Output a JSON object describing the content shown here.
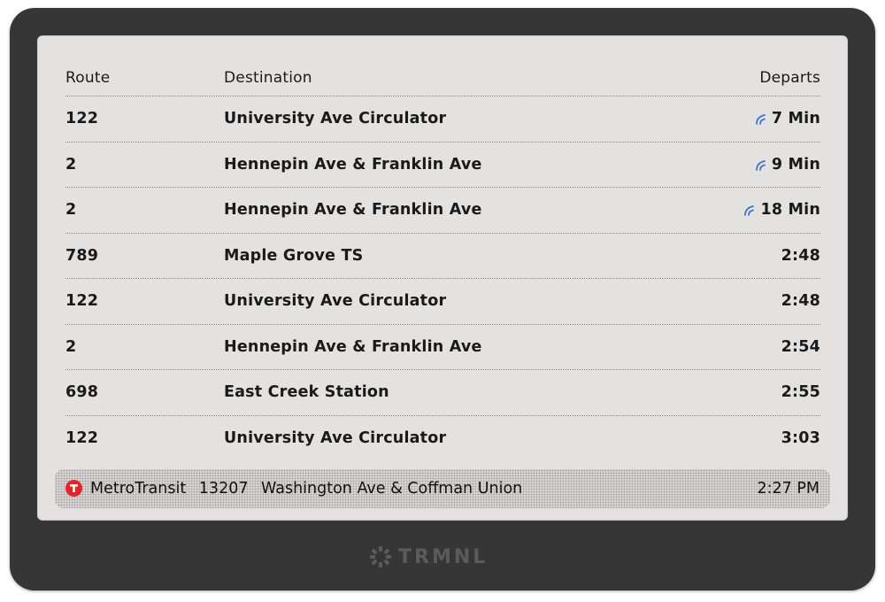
{
  "table": {
    "headers": {
      "route": "Route",
      "destination": "Destination",
      "departs": "Departs"
    },
    "rows": [
      {
        "route": "122",
        "destination": "University Ave Circulator",
        "departs": "7 Min",
        "live": true
      },
      {
        "route": "2",
        "destination": "Hennepin Ave & Franklin Ave",
        "departs": "9 Min",
        "live": true
      },
      {
        "route": "2",
        "destination": "Hennepin Ave & Franklin Ave",
        "departs": "18 Min",
        "live": true
      },
      {
        "route": "789",
        "destination": "Maple Grove TS",
        "departs": "2:48",
        "live": false
      },
      {
        "route": "122",
        "destination": "University Ave Circulator",
        "departs": "2:48",
        "live": false
      },
      {
        "route": "2",
        "destination": "Hennepin Ave & Franklin Ave",
        "departs": "2:54",
        "live": false
      },
      {
        "route": "698",
        "destination": "East Creek Station",
        "departs": "2:55",
        "live": false
      },
      {
        "route": "122",
        "destination": "University Ave Circulator",
        "departs": "3:03",
        "live": false
      }
    ]
  },
  "footer": {
    "agency": "MetroTransit",
    "stop_id": "13207",
    "stop_name": "Washington Ave & Coffman Union",
    "time": "2:27 PM",
    "logo_icon": "metro-transit-logo-icon",
    "logo_color": "#e0262d"
  },
  "device": {
    "brand": "TRMNL",
    "brand_icon": "trmnl-gear-icon"
  },
  "colors": {
    "live_icon": "#3a6fd8",
    "screen_bg": "#e3e2e1",
    "bezel": "#363636"
  }
}
